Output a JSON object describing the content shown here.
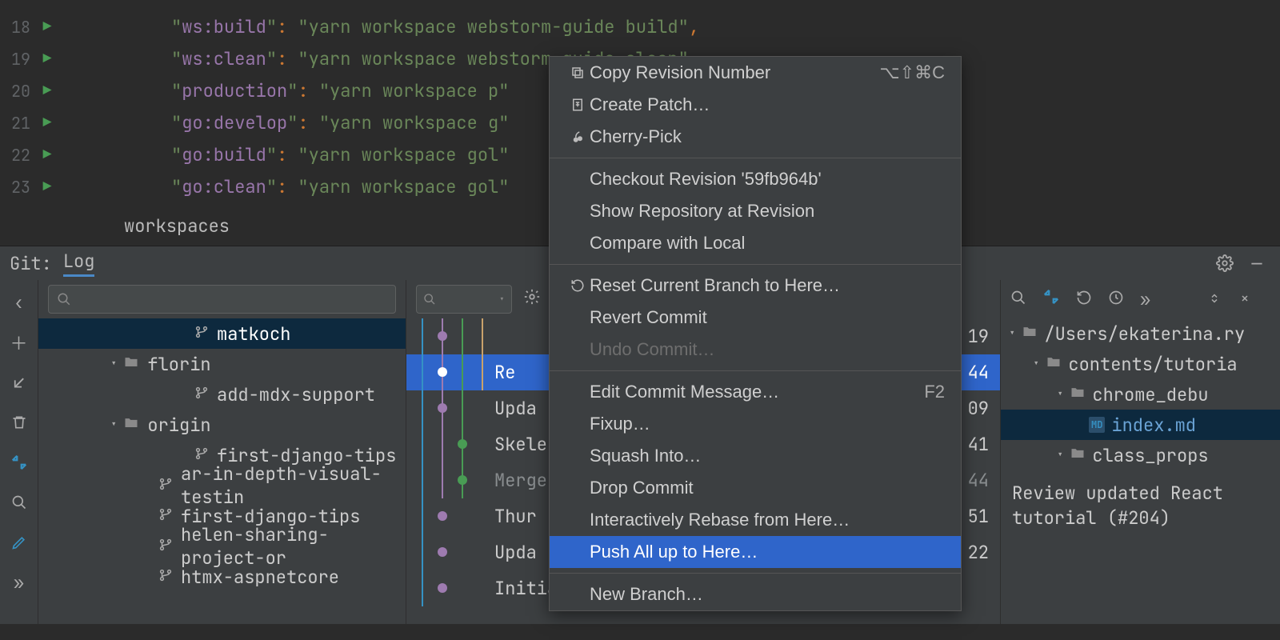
{
  "editor": {
    "lines": [
      {
        "num": "18",
        "key": "ws:build",
        "val": "yarn workspace webstorm-guide build",
        "comma": true
      },
      {
        "num": "19",
        "key": "ws:clean",
        "val": "yarn workspace webstorm-guide clean",
        "comma": false
      },
      {
        "num": "20",
        "key": "production",
        "val": "yarn workspace p",
        "comma": false
      },
      {
        "num": "21",
        "key": "go:develop",
        "val": "yarn workspace g",
        "comma": false
      },
      {
        "num": "22",
        "key": "go:build",
        "val": "yarn workspace gol",
        "comma": false
      },
      {
        "num": "23",
        "key": "go:clean",
        "val": "yarn workspace gol",
        "comma": false
      }
    ],
    "breadcrumb": "workspaces"
  },
  "git_header": {
    "label": "Git:",
    "tab": "Log"
  },
  "branch_tree": [
    {
      "level": 3,
      "type": "branch",
      "label": "matkoch",
      "selected": true
    },
    {
      "level": 1,
      "type": "folder",
      "label": "florin",
      "expanded": true
    },
    {
      "level": 3,
      "type": "branch",
      "label": "add-mdx-support"
    },
    {
      "level": 1,
      "type": "folder",
      "label": "origin",
      "expanded": true
    },
    {
      "level": 3,
      "type": "branch",
      "label": "first-django-tips"
    },
    {
      "level": 2,
      "type": "branch",
      "label": "ar-in-depth-visual-testin"
    },
    {
      "level": 2,
      "type": "branch",
      "label": "first-django-tips"
    },
    {
      "level": 2,
      "type": "branch",
      "label": "helen-sharing-project-or"
    },
    {
      "level": 2,
      "type": "branch",
      "label": "htmx-aspnetcore"
    }
  ],
  "commits": [
    {
      "msg": "",
      "time": "19",
      "merge": false
    },
    {
      "msg": "Re",
      "time": "44",
      "merge": false,
      "selected": true
    },
    {
      "msg": "Upda",
      "time": "09",
      "merge": false
    },
    {
      "msg": "Skele",
      "time": "41",
      "merge": false
    },
    {
      "msg": "Merge",
      "time": "44",
      "merge": true
    },
    {
      "msg": "Thur",
      "time": "51",
      "merge": false
    },
    {
      "msg": "Upda",
      "time": "22",
      "merge": false
    },
    {
      "msg": "Initia",
      "time": "",
      "merge": false
    }
  ],
  "details": {
    "tree": [
      {
        "level": 0,
        "icon": "folder",
        "label": "/Users/ekaterina.ry"
      },
      {
        "level": 1,
        "icon": "folder",
        "label": "contents/tutoria"
      },
      {
        "level": 2,
        "icon": "folder",
        "label": "chrome_debu"
      },
      {
        "level": 3,
        "icon": "md",
        "label": "index.md",
        "selected": true
      },
      {
        "level": 2,
        "icon": "folder",
        "label": "class_props"
      }
    ],
    "summary": "Review updated React tutorial (#204)"
  },
  "context_menu": [
    {
      "type": "item",
      "icon": "copy",
      "label": "Copy Revision Number",
      "shortcut": "⌥⇧⌘C"
    },
    {
      "type": "item",
      "icon": "patch",
      "label": "Create Patch…"
    },
    {
      "type": "item",
      "icon": "cherry",
      "label": "Cherry-Pick"
    },
    {
      "type": "sep"
    },
    {
      "type": "item",
      "label": "Checkout Revision '59fb964b'"
    },
    {
      "type": "item",
      "label": "Show Repository at Revision"
    },
    {
      "type": "item",
      "label": "Compare with Local"
    },
    {
      "type": "sep"
    },
    {
      "type": "item",
      "icon": "undo",
      "label": "Reset Current Branch to Here…"
    },
    {
      "type": "item",
      "label": "Revert Commit"
    },
    {
      "type": "item",
      "label": "Undo Commit…",
      "disabled": true
    },
    {
      "type": "sep"
    },
    {
      "type": "item",
      "label": "Edit Commit Message…",
      "shortcut": "F2"
    },
    {
      "type": "item",
      "label": "Fixup…"
    },
    {
      "type": "item",
      "label": "Squash Into…"
    },
    {
      "type": "item",
      "label": "Drop Commit"
    },
    {
      "type": "item",
      "label": "Interactively Rebase from Here…"
    },
    {
      "type": "item",
      "label": "Push All up to Here…",
      "highlight": true
    },
    {
      "type": "sep"
    },
    {
      "type": "item",
      "label": "New Branch…"
    }
  ]
}
